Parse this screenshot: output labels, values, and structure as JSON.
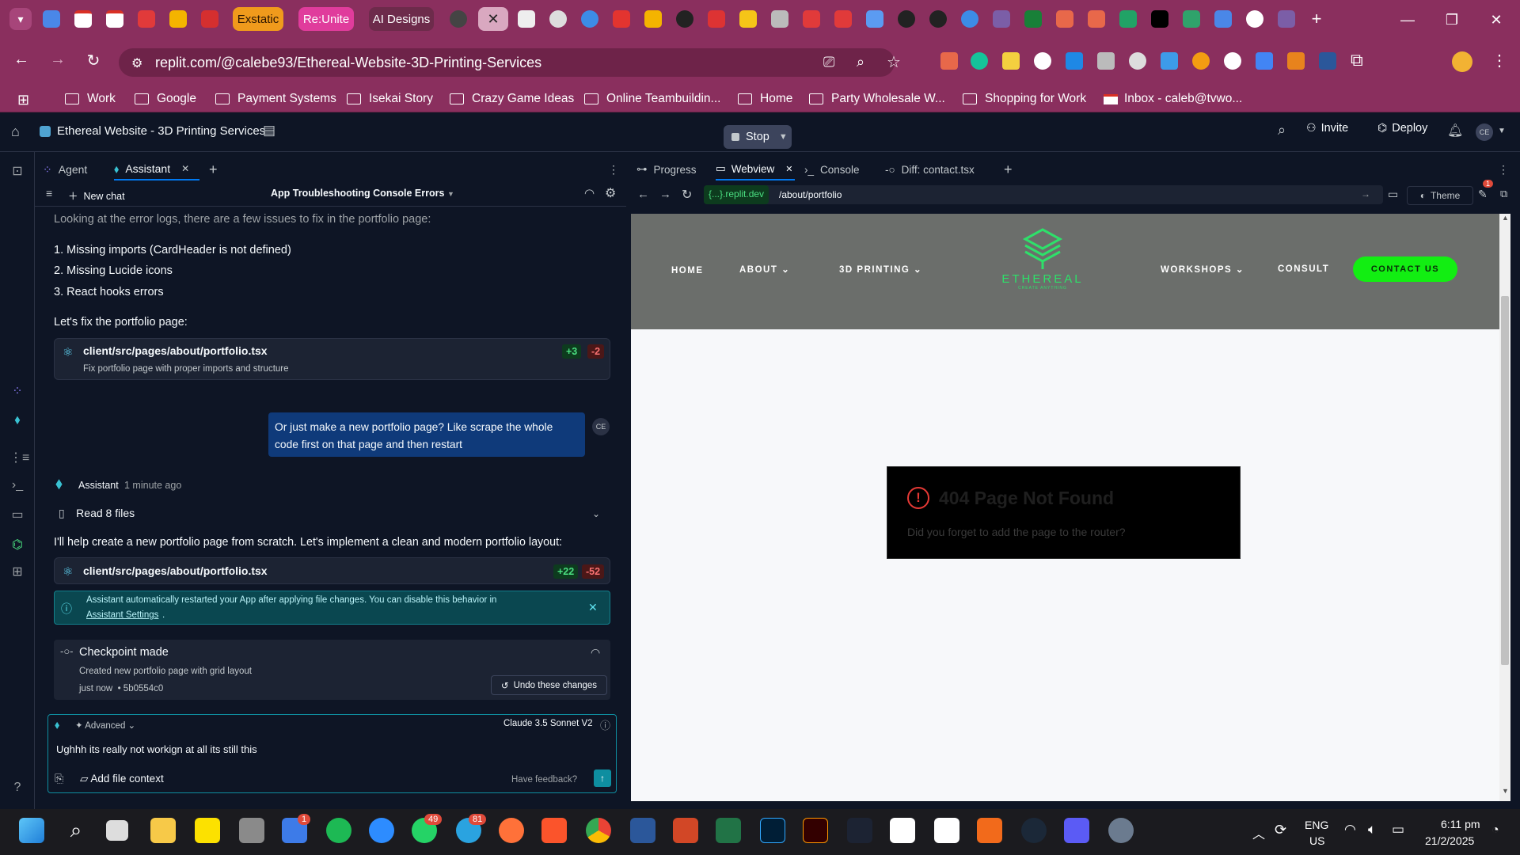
{
  "browser": {
    "tabs": [
      "Exstatic",
      "Re:Unite",
      "AI Designs"
    ],
    "address": "replit.com/@calebe93/Ethereal-Website-3D-Printing-Services",
    "bookmarks": [
      "Work",
      "Google",
      "Payment Systems",
      "Isekai Story",
      "Crazy Game Ideas",
      "Online Teambuildin...",
      "Home",
      "Party Wholesale W...",
      "Shopping for Work",
      "Inbox - caleb@tvwo..."
    ]
  },
  "replit": {
    "project_title": "Ethereal Website - 3D Printing Services",
    "stop_label": "Stop",
    "invite_label": "Invite",
    "deploy_label": "Deploy",
    "avatar_initials": "CE"
  },
  "left_tabs": [
    "Agent",
    "Assistant"
  ],
  "chat": {
    "new_chat": "New chat",
    "thread_title": "App Troubleshooting Console Errors",
    "intro": "Looking at the error logs, there are a few issues to fix in the portfolio page:",
    "issues": [
      "1. Missing imports (CardHeader is not defined)",
      "2. Missing Lucide icons",
      "3. React hooks errors"
    ],
    "fix_line": "Let's fix the portfolio page:",
    "file1": {
      "path": "client/src/pages/about/portfolio.tsx",
      "desc": "Fix portfolio page with proper imports and structure",
      "plus": "+3",
      "minus": "-2"
    },
    "user_msg": "Or just make a new portfolio page? Like scrape the whole code first on that page and then restart",
    "user_initials": "CE",
    "assistant_name": "Assistant",
    "assistant_time": "1 minute ago",
    "read_files": "Read 8 files",
    "reply": "I'll help create a new portfolio page from scratch. Let's implement a clean and modern portfolio layout:",
    "file2": {
      "path": "client/src/pages/about/portfolio.tsx",
      "plus": "+22",
      "minus": "-52"
    },
    "notice": "Assistant automatically restarted your App after applying file changes. You can disable this behavior in",
    "notice_link": "Assistant Settings",
    "checkpoint_title": "Checkpoint made",
    "checkpoint_desc": "Created new portfolio page with grid layout",
    "checkpoint_meta": "just now  • 5b0554c0",
    "undo_label": "Undo these changes",
    "input_mode": "Advanced",
    "model": "Claude 3.5 Sonnet V2",
    "input_value": "Ughhh its really not workign at all its still this",
    "add_context": "Add file context",
    "feedback": "Have feedback?"
  },
  "right_tabs": [
    "Progress",
    "Webview",
    "Console",
    "Diff: contact.tsx"
  ],
  "webview": {
    "domain": "{...}.replit.dev",
    "path": "/about/portfolio",
    "theme_label": "Theme",
    "notif_count": "1"
  },
  "site": {
    "nav": [
      "HOME",
      "ABOUT",
      "3D PRINTING",
      "WORKSHOPS",
      "CONSULT"
    ],
    "cta": "CONTACT US",
    "logo_text": "ETHEREAL",
    "logo_sub": "CREATE ANYTHING",
    "error_title": "404 Page Not Found",
    "error_desc": "Did you forget to add the page to the router?"
  },
  "taskbar": {
    "lang_top": "ENG",
    "lang_bottom": "US",
    "time": "6:11 pm",
    "date": "21/2/2025",
    "badges": [
      "1",
      "49",
      "81"
    ]
  }
}
